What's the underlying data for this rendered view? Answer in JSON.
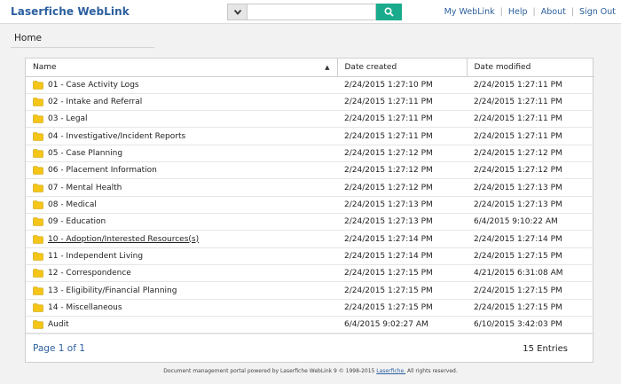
{
  "header": {
    "logo": "Laserfiche WebLink",
    "search_placeholder": "",
    "nav": [
      "My WebLink",
      "Help",
      "About",
      "Sign Out"
    ]
  },
  "breadcrumb": "Home",
  "table": {
    "columns": [
      "Name",
      "Date created",
      "Date modified"
    ],
    "rows": [
      {
        "name": "01 - Case Activity Logs",
        "created": "2/24/2015 1:27:10 PM",
        "modified": "2/24/2015 1:27:11 PM"
      },
      {
        "name": "02 - Intake and Referral",
        "created": "2/24/2015 1:27:11 PM",
        "modified": "2/24/2015 1:27:11 PM"
      },
      {
        "name": "03 - Legal",
        "created": "2/24/2015 1:27:11 PM",
        "modified": "2/24/2015 1:27:11 PM"
      },
      {
        "name": "04 - Investigative/Incident Reports",
        "created": "2/24/2015 1:27:11 PM",
        "modified": "2/24/2015 1:27:11 PM"
      },
      {
        "name": "05 - Case Planning",
        "created": "2/24/2015 1:27:12 PM",
        "modified": "2/24/2015 1:27:12 PM"
      },
      {
        "name": "06 - Placement Information",
        "created": "2/24/2015 1:27:12 PM",
        "modified": "2/24/2015 1:27:12 PM"
      },
      {
        "name": "07 - Mental Health",
        "created": "2/24/2015 1:27:12 PM",
        "modified": "2/24/2015 1:27:13 PM"
      },
      {
        "name": "08 - Medical",
        "created": "2/24/2015 1:27:13 PM",
        "modified": "2/24/2015 1:27:13 PM"
      },
      {
        "name": "09 - Education",
        "created": "2/24/2015 1:27:13 PM",
        "modified": "6/4/2015 9:10:22 AM"
      },
      {
        "name": "10 - Adoption/Interested Resources(s)",
        "created": "2/24/2015 1:27:14 PM",
        "modified": "2/24/2015 1:27:14 PM"
      },
      {
        "name": "11 - Independent Living",
        "created": "2/24/2015 1:27:14 PM",
        "modified": "2/24/2015 1:27:15 PM"
      },
      {
        "name": "12 - Correspondence",
        "created": "2/24/2015 1:27:15 PM",
        "modified": "4/21/2015 6:31:08 AM"
      },
      {
        "name": "13 - Eligibility/Financial Planning",
        "created": "2/24/2015 1:27:15 PM",
        "modified": "2/24/2015 1:27:15 PM"
      },
      {
        "name": "14 - Miscellaneous",
        "created": "2/24/2015 1:27:15 PM",
        "modified": "2/24/2015 1:27:15 PM"
      },
      {
        "name": "Audit",
        "created": "6/4/2015 9:02:27 AM",
        "modified": "6/10/2015 3:42:03 PM"
      }
    ]
  },
  "pagination": {
    "page_info": "Page 1 of 1",
    "entries": "15 Entries"
  },
  "footer": {
    "text_before": "Document management portal powered by Laserfiche WebLink 9 © 1998-2015",
    "link": "Laserfiche.",
    "text_after": "All rights reserved."
  },
  "colors": {
    "brand": "#2b5f9e",
    "search_button": "#1aab8c",
    "folder": "#f5c518"
  }
}
